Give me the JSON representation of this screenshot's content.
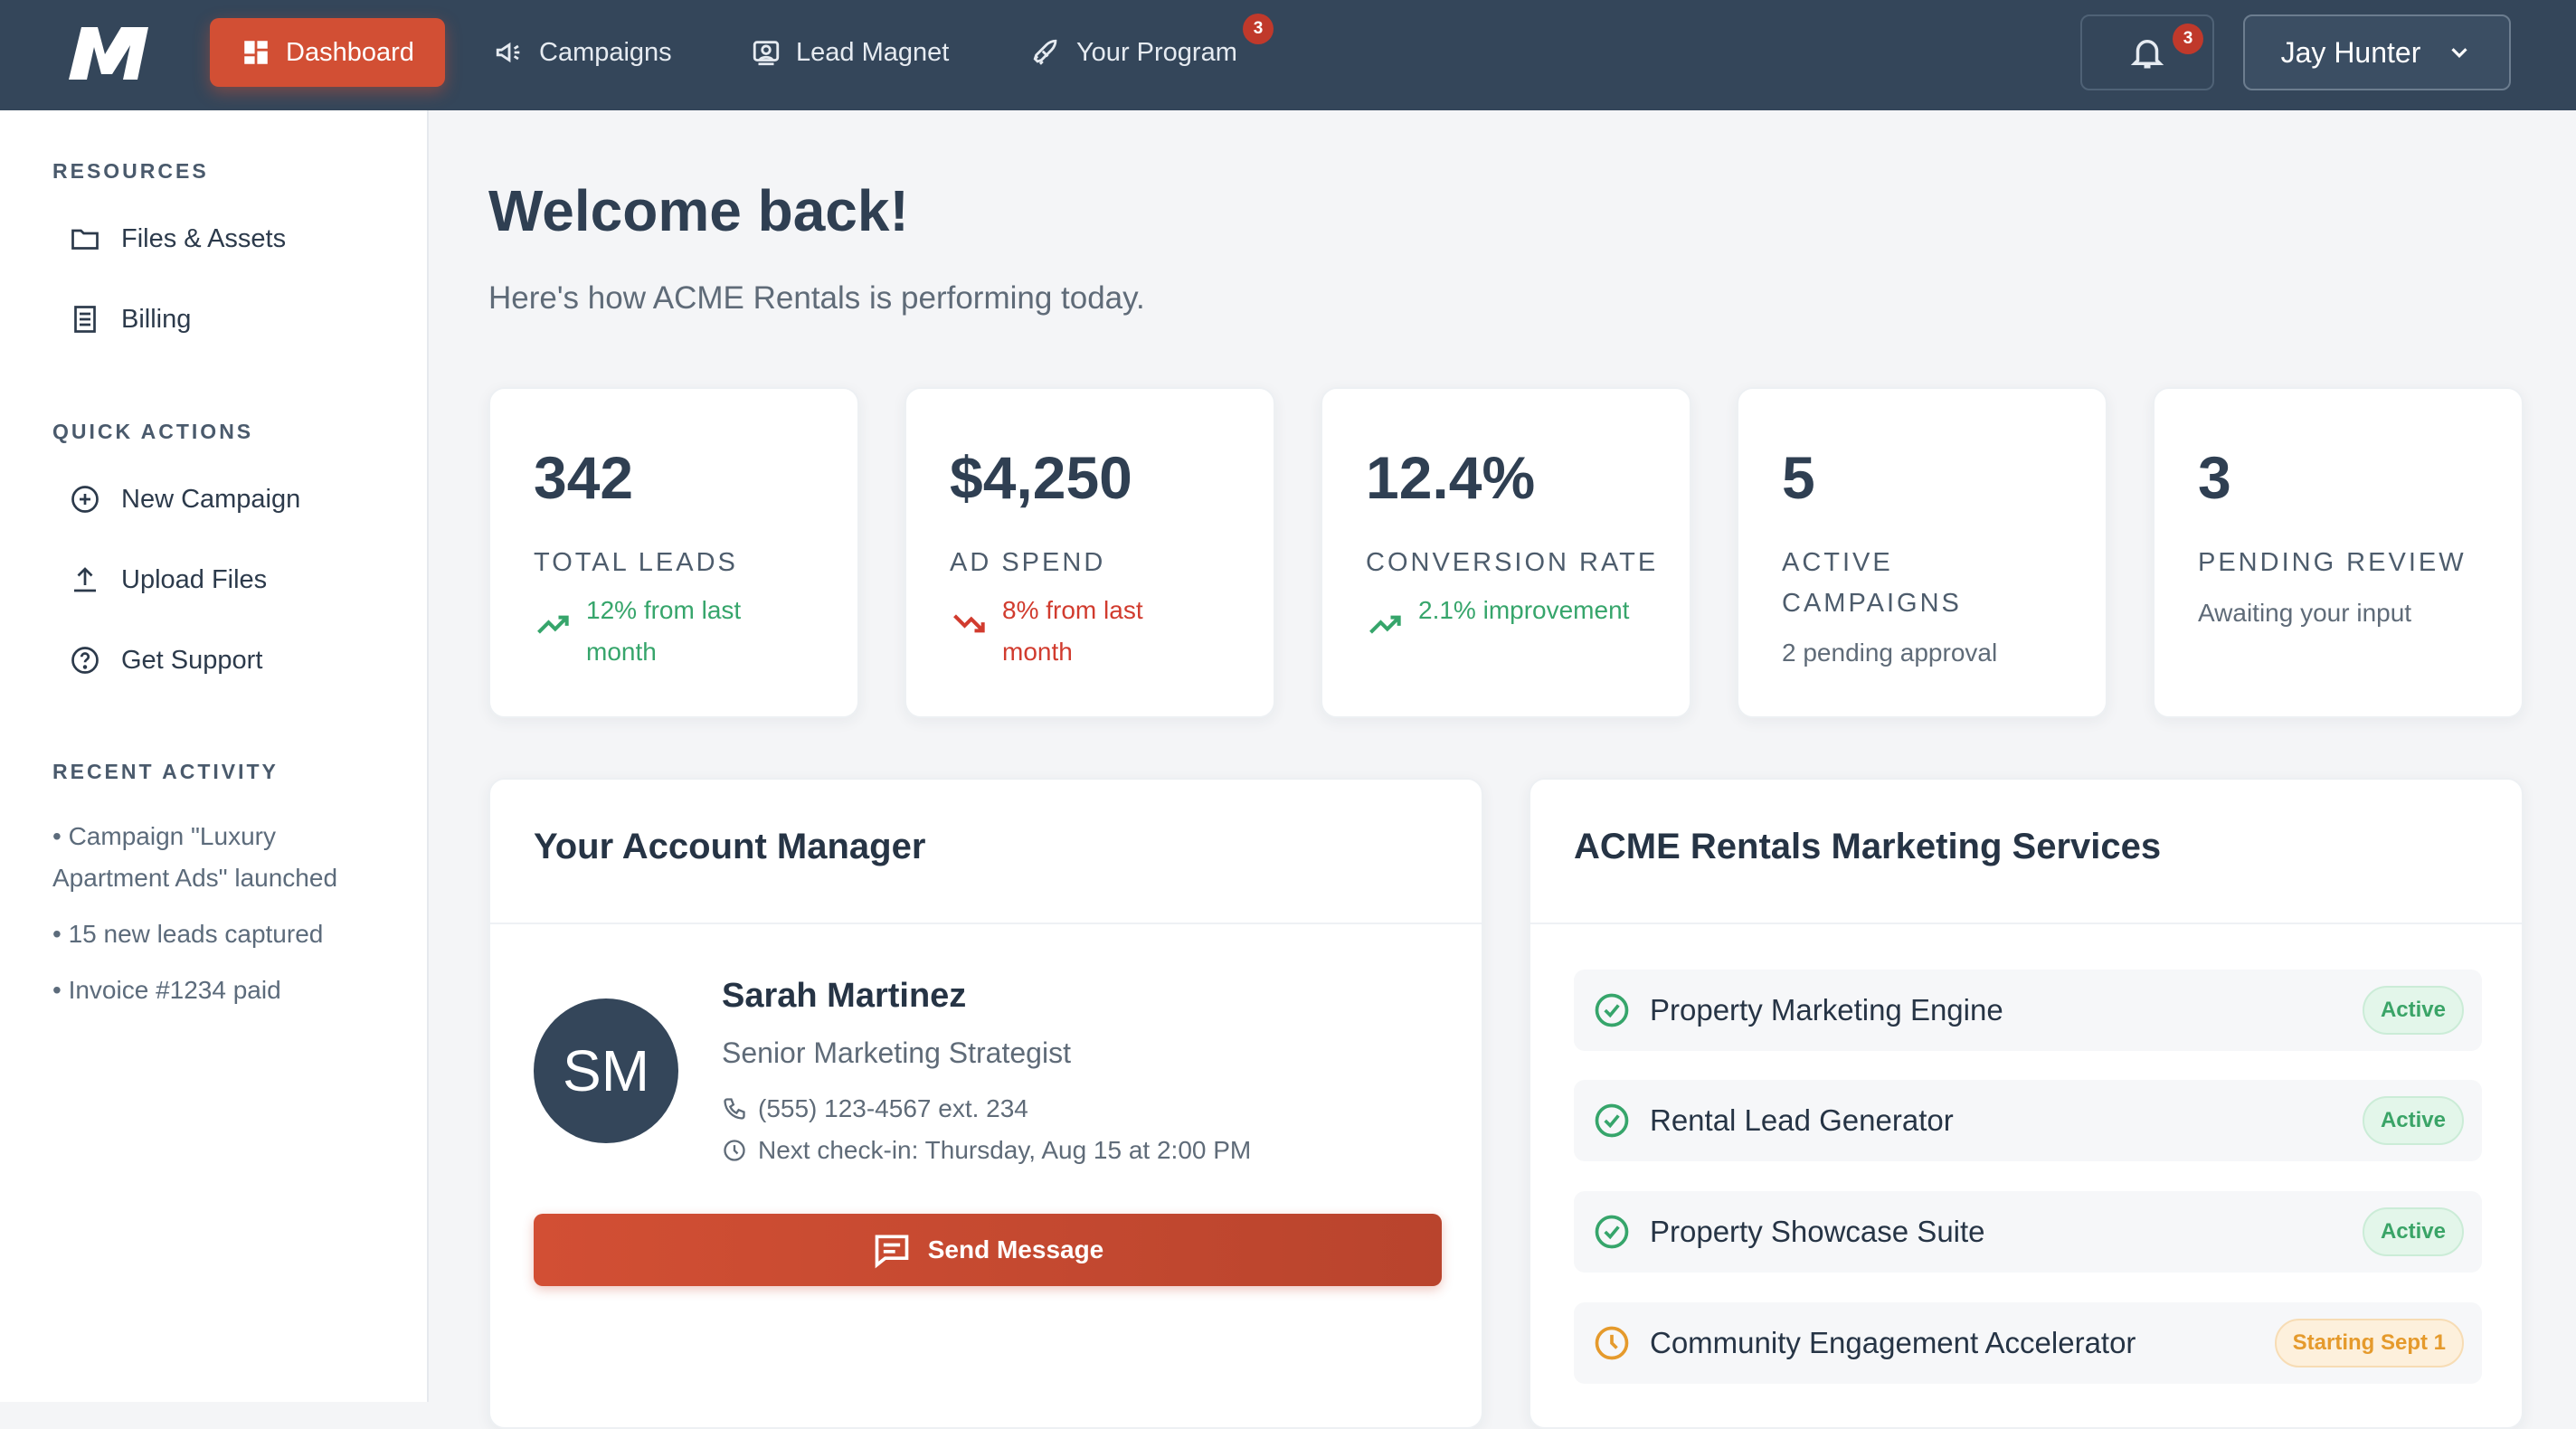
{
  "nav": {
    "items": [
      {
        "label": "Dashboard",
        "icon": "dashboard-icon",
        "active": true
      },
      {
        "label": "Campaigns",
        "icon": "megaphone-icon"
      },
      {
        "label": "Lead Magnet",
        "icon": "lead-magnet-icon"
      },
      {
        "label": "Your Program",
        "icon": "rocket-icon",
        "badge": "3"
      }
    ],
    "notifications_badge": "3",
    "user_name": "Jay Hunter"
  },
  "sidebar": {
    "resources_heading": "RESOURCES",
    "resources": [
      {
        "label": "Files & Assets",
        "icon": "folder-icon"
      },
      {
        "label": "Billing",
        "icon": "billing-icon"
      }
    ],
    "quick_heading": "QUICK ACTIONS",
    "quick_actions": [
      {
        "label": "New Campaign",
        "icon": "plus-circle-icon"
      },
      {
        "label": "Upload Files",
        "icon": "upload-icon"
      },
      {
        "label": "Get Support",
        "icon": "help-icon"
      }
    ],
    "activity_heading": "RECENT ACTIVITY",
    "activity": [
      "• Campaign \"Luxury Apartment Ads\" launched",
      "• 15 new leads captured",
      "• Invoice #1234 paid"
    ]
  },
  "main": {
    "title": "Welcome back!",
    "subtitle": "Here's how ACME Rentals is performing today."
  },
  "stats": [
    {
      "value": "342",
      "label": "TOTAL LEADS",
      "trend": "12% from last month",
      "direction": "up"
    },
    {
      "value": "$4,250",
      "label": "AD SPEND",
      "trend": "8% from last month",
      "direction": "down"
    },
    {
      "value": "12.4%",
      "label": "CONVERSION RATE",
      "trend": "2.1% improvement",
      "direction": "up"
    },
    {
      "value": "5",
      "label": "ACTIVE CAMPAIGNS",
      "note": "2 pending approval"
    },
    {
      "value": "3",
      "label": "PENDING REVIEW",
      "note": "Awaiting your input"
    }
  ],
  "manager": {
    "heading": "Your Account Manager",
    "initials": "SM",
    "name": "Sarah Martinez",
    "role": "Senior Marketing Strategist",
    "phone": "(555) 123-4567 ext. 234",
    "checkin": "Next check-in: Thursday, Aug 15 at 2:00 PM",
    "button": "Send Message"
  },
  "services": {
    "heading": "ACME Rentals Marketing Services",
    "items": [
      {
        "name": "Property Marketing Engine",
        "status": "Active"
      },
      {
        "name": "Rental Lead Generator",
        "status": "Active"
      },
      {
        "name": "Property Showcase Suite",
        "status": "Active"
      },
      {
        "name": "Community Engagement Accelerator",
        "status": "Starting Sept 1"
      }
    ]
  },
  "colors": {
    "nav_bg": "#34465a",
    "accent": "#d24f34",
    "positive": "#36a56b",
    "negative": "#d13b2e",
    "pending": "#e59a2c"
  }
}
